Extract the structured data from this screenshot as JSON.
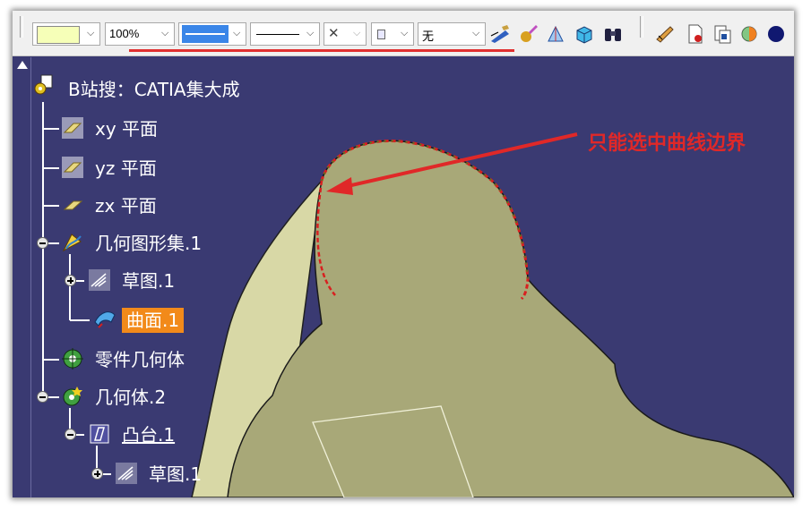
{
  "toolbar": {
    "zoom_value": "100%",
    "layer_value": "无",
    "style_x_symbol": "✕",
    "colors": {
      "fill_swatch": "#f6ffb8",
      "line_color": "#3a86e8"
    }
  },
  "tree": {
    "root_label": "B站搜：CATIA集大成",
    "items": [
      {
        "label": "xy 平面",
        "icon": "plane-icon"
      },
      {
        "label": "yz 平面",
        "icon": "plane-icon"
      },
      {
        "label": "zx 平面",
        "icon": "plane-icon"
      },
      {
        "label": "几何图形集.1",
        "icon": "geometrical-set-icon"
      },
      {
        "label": "草图.1",
        "icon": "sketch-icon"
      },
      {
        "label": "曲面.1",
        "icon": "surface-icon"
      },
      {
        "label": "零件几何体",
        "icon": "part-body-icon"
      },
      {
        "label": "几何体.2",
        "icon": "body-icon"
      },
      {
        "label": "凸台.1",
        "icon": "pad-icon"
      },
      {
        "label": "草图.1",
        "icon": "sketch-icon"
      }
    ]
  },
  "annotation": {
    "text": "只能选中曲线边界",
    "color": "#e02828"
  },
  "viewport": {
    "surface_color": "#a8a878",
    "background": "#3a3a72"
  }
}
